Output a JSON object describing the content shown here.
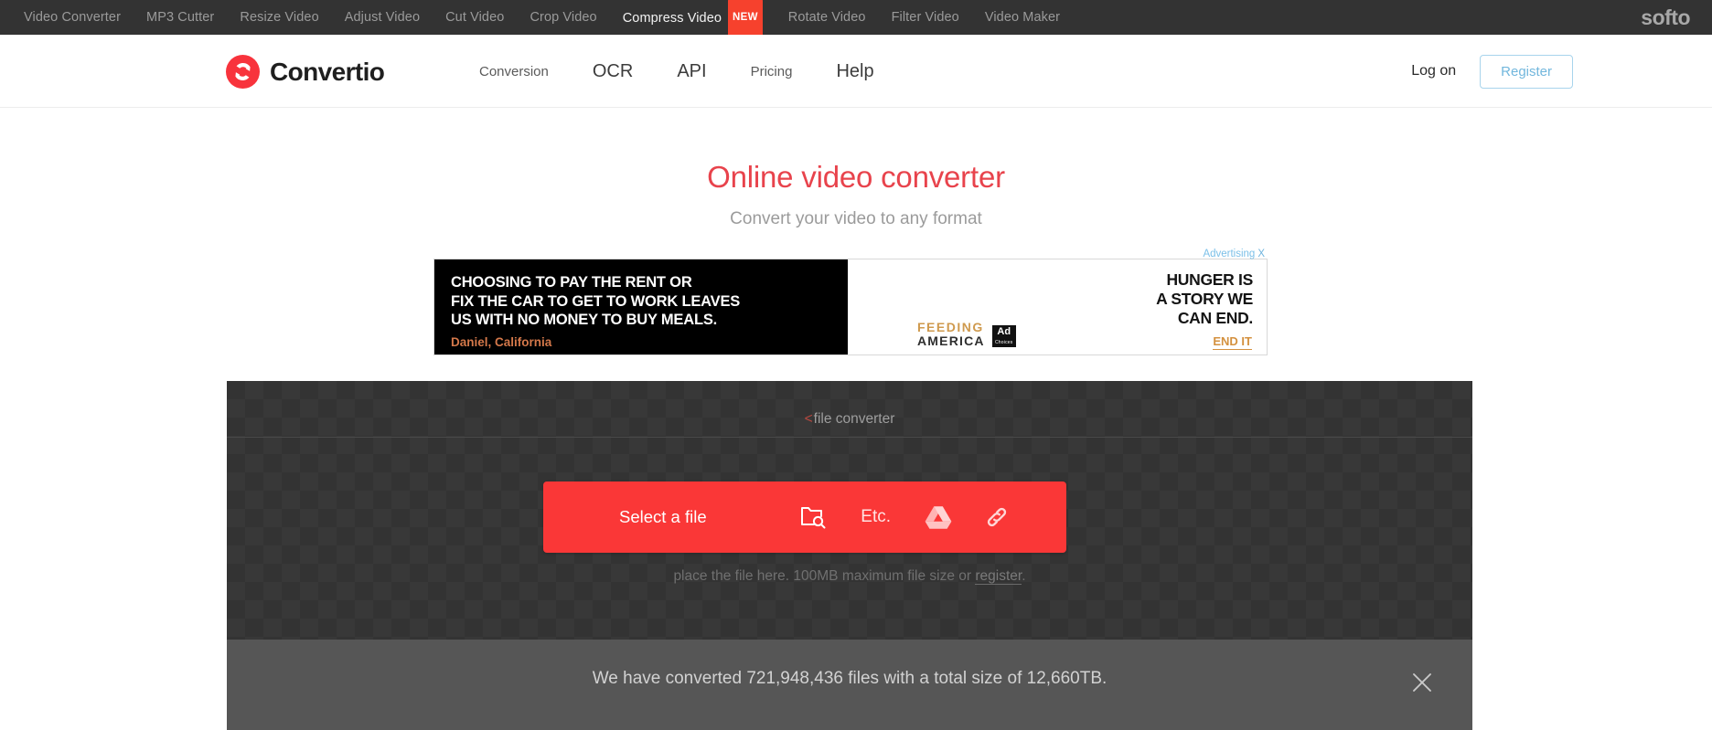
{
  "promo_bar": {
    "items": [
      {
        "label": "Video Converter",
        "active": false,
        "badge": ""
      },
      {
        "label": "MP3 Cutter",
        "active": false,
        "badge": ""
      },
      {
        "label": "Resize Video",
        "active": false,
        "badge": ""
      },
      {
        "label": "Adjust Video",
        "active": false,
        "badge": ""
      },
      {
        "label": "Cut Video",
        "active": false,
        "badge": ""
      },
      {
        "label": "Crop Video",
        "active": false,
        "badge": ""
      },
      {
        "label": "Compress Video",
        "active": true,
        "badge": "NEW"
      },
      {
        "label": "Rotate Video",
        "active": false,
        "badge": ""
      },
      {
        "label": "Filter Video",
        "active": false,
        "badge": ""
      },
      {
        "label": "Video Maker",
        "active": false,
        "badge": ""
      }
    ],
    "site_logo": "softo"
  },
  "header": {
    "brand_name": "Convertio",
    "brand_icon": "convertio-swirl-icon",
    "nav": [
      {
        "label": "Conversion",
        "size": "sm"
      },
      {
        "label": "OCR",
        "size": "lg"
      },
      {
        "label": "API",
        "size": "lg"
      },
      {
        "label": "Pricing",
        "size": "sm"
      },
      {
        "label": "Help",
        "size": "lg"
      }
    ],
    "logon_label": "Log on",
    "register_label": "Register"
  },
  "hero": {
    "title": "Online video converter",
    "subtitle": "Convert your video to any format"
  },
  "advertisement": {
    "label": "Advertising",
    "close_label": "X",
    "left_lines": [
      "CHOOSING TO PAY THE RENT OR",
      "FIX THE CAR TO GET TO WORK LEAVES",
      "US WITH NO MONEY TO BUY MEALS."
    ],
    "attribution": "Daniel, California",
    "right_lines": [
      "HUNGER IS",
      "A STORY WE",
      "CAN END."
    ],
    "cta": "END IT",
    "sponsor_top": "FEEDING",
    "sponsor_bottom": "AMERICA",
    "adchoices_label": "Ad",
    "adchoices_sub": "Choices"
  },
  "dropzone": {
    "caption_caret": "<",
    "caption": "file converter",
    "select_file_label": "Select a file",
    "etc_label": "Etc.",
    "icons": {
      "browse": "folder-search-icon",
      "drive": "google-drive-icon",
      "link": "link-chain-icon"
    },
    "hint_prefix": "place the file here. 100MB maximum file size or ",
    "hint_register": "register",
    "hint_suffix": "."
  },
  "stats": {
    "text": "We have converted 721,948,436 files with a total size of 12,660TB.",
    "converted_files": "721,948,436",
    "total_size": "12,660TB",
    "close_icon": "close-icon"
  },
  "colors": {
    "accent_red": "#fa3737",
    "title_red": "#e8434c",
    "promo_bar": "#333333",
    "dropzone": "#333333",
    "stats_bar": "#565656",
    "register_border": "#a8d4ec",
    "ad_label_blue": "#7cc0e8"
  }
}
